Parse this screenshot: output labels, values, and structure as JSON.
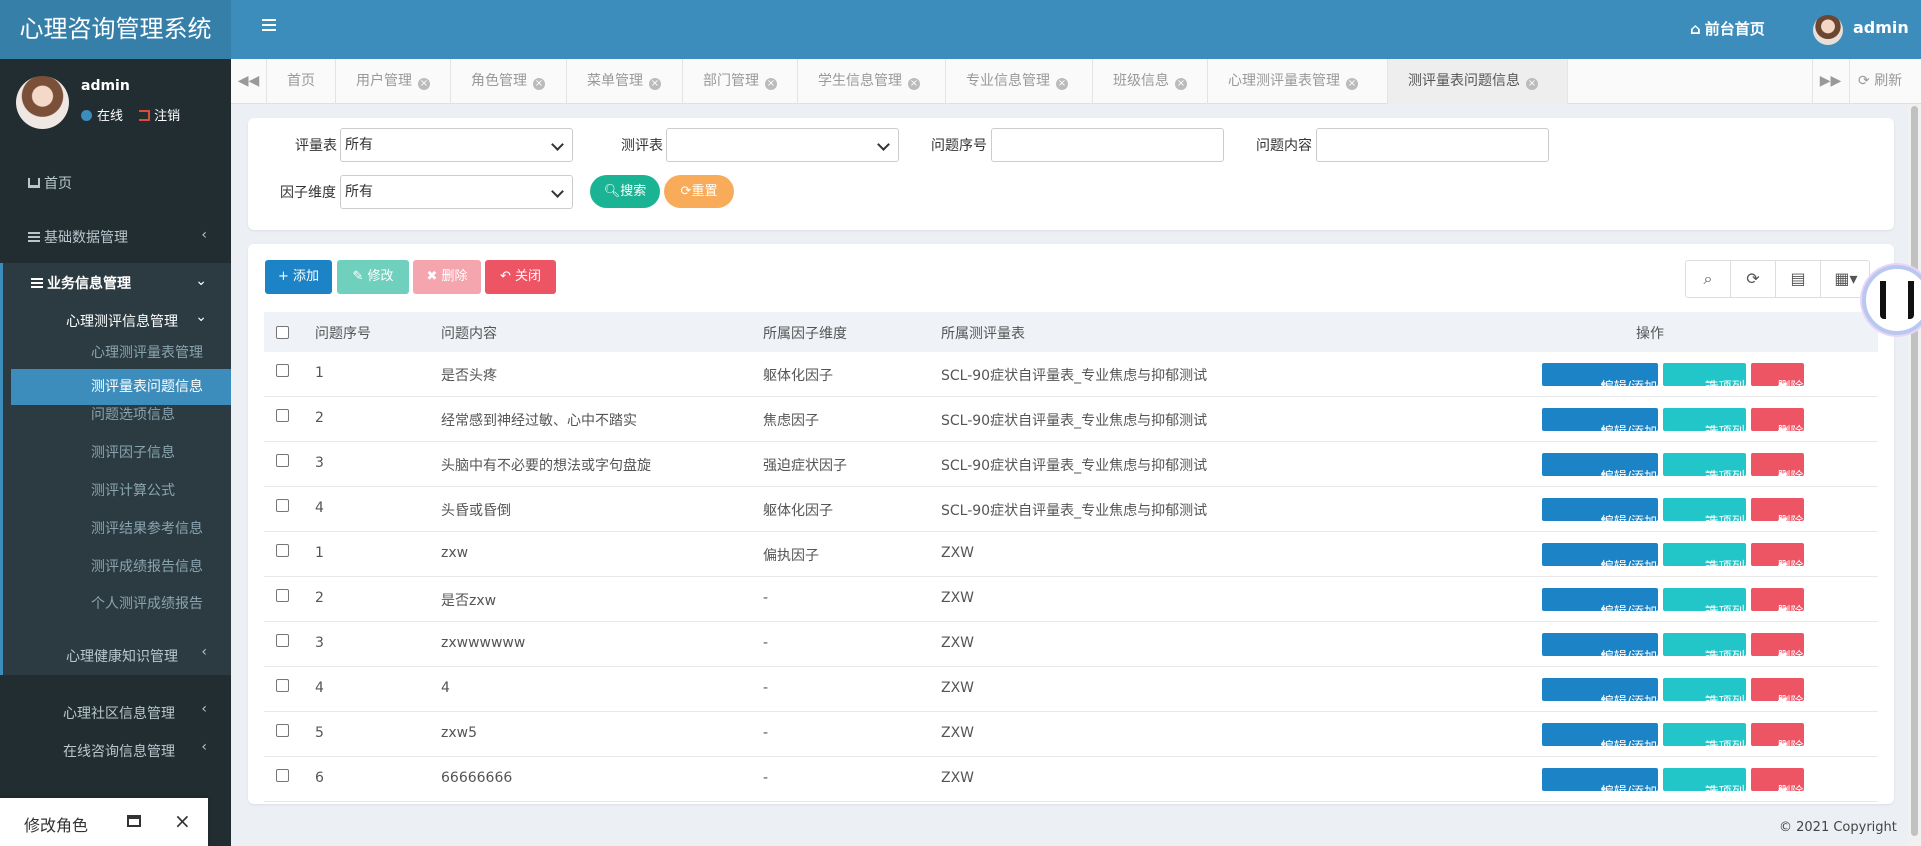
{
  "app_title": "心理咨询管理系统",
  "header": {
    "front_label": "前台首页",
    "user": "admin"
  },
  "user_panel": {
    "name": "admin",
    "status": "在线",
    "logout": "注销"
  },
  "sidebar": {
    "home": "首页",
    "basic": "基础数据管理",
    "business": "业务信息管理",
    "psych_group": "心理测评信息管理",
    "sub_items": [
      "心理测评量表管理",
      "测评量表问题信息",
      "问题选项信息",
      "测评因子信息",
      "测评计算公式",
      "测评结果参考信息",
      "测评成绩报告信息",
      "个人测评成绩报告"
    ],
    "more": [
      "心理健康知识管理",
      "心理社区信息管理",
      "在线咨询信息管理"
    ]
  },
  "minimized_window": "修改角色",
  "tabs": [
    "首页",
    "用户管理",
    "角色管理",
    "菜单管理",
    "部门管理",
    "学生信息管理",
    "专业信息管理",
    "班级信息",
    "心理测评量表管理",
    "测评量表问题信息"
  ],
  "refresh_label": "刷新",
  "filters": {
    "scale_label": "评量表",
    "scale_value": "所有",
    "test_label": "测评表",
    "test_value": "",
    "qno_label": "问题序号",
    "qcontent_label": "问题内容",
    "factor_label": "因子维度",
    "factor_value": "所有",
    "search": "搜索",
    "reset": "重置"
  },
  "toolbar": {
    "add": "添加",
    "edit": "修改",
    "delete": "删除",
    "close": "关闭"
  },
  "table": {
    "headers": [
      "问题序号",
      "问题内容",
      "所属因子维度",
      "所属测评量表",
      "操作"
    ],
    "rows": [
      {
        "no": "1",
        "content": "是否头疼",
        "factor": "躯体化因子",
        "scale": "SCL-90症状自评量表_专业焦虑与抑郁测试"
      },
      {
        "no": "2",
        "content": "经常感到神经过敏、心中不踏实",
        "factor": "焦虑因子",
        "scale": "SCL-90症状自评量表_专业焦虑与抑郁测试"
      },
      {
        "no": "3",
        "content": "头脑中有不必要的想法或字句盘旋",
        "factor": "强迫症状因子",
        "scale": "SCL-90症状自评量表_专业焦虑与抑郁测试"
      },
      {
        "no": "4",
        "content": "头昏或昏倒",
        "factor": "躯体化因子",
        "scale": "SCL-90症状自评量表_专业焦虑与抑郁测试"
      },
      {
        "no": "1",
        "content": "zxw",
        "factor": "偏执因子",
        "scale": "ZXW"
      },
      {
        "no": "2",
        "content": "是否zxw",
        "factor": "-",
        "scale": "ZXW"
      },
      {
        "no": "3",
        "content": "zxwwwwww",
        "factor": "-",
        "scale": "ZXW"
      },
      {
        "no": "4",
        "content": "4",
        "factor": "-",
        "scale": "ZXW"
      },
      {
        "no": "5",
        "content": "zxw5",
        "factor": "-",
        "scale": "ZXW"
      },
      {
        "no": "6",
        "content": "66666666",
        "factor": "-",
        "scale": "ZXW"
      }
    ],
    "actions": {
      "edit": "编辑/添加选项",
      "options": "选项列表",
      "delete": "删除"
    }
  },
  "copyright": "© 2021 Copyright",
  "colors": {
    "primary": "#3c8dbc",
    "sidebar": "#222d32",
    "teal": "#1ab394",
    "orange": "#f8ac59",
    "red": "#ed5565",
    "blue": "#1c84c6",
    "cyan": "#23c6c8"
  }
}
